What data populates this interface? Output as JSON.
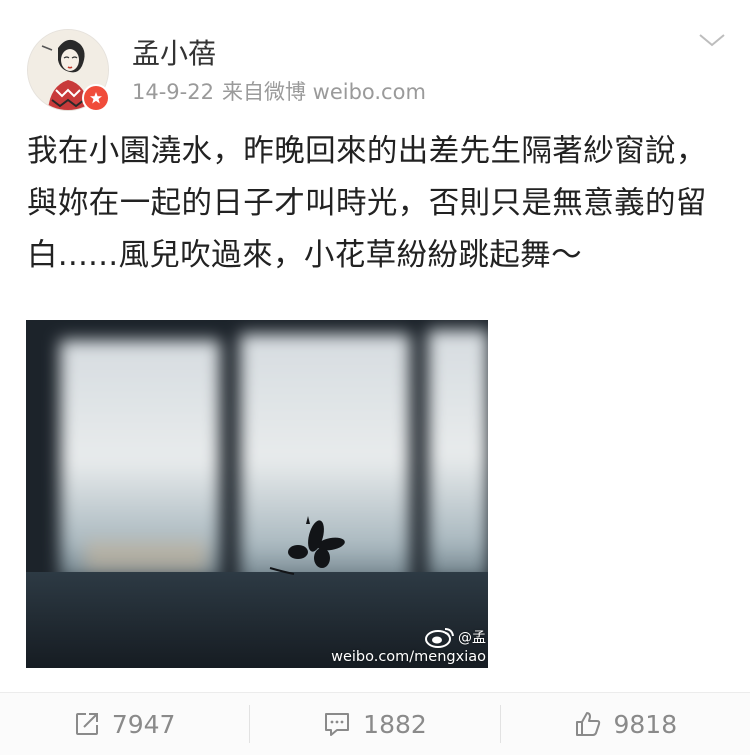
{
  "post": {
    "author": "孟小蓓",
    "date": "14-9-22",
    "source": "来自微博 weibo.com",
    "text": "我在小園澆水，昨晚回來的出差先生隔著紗窗說，與妳在一起的日子才叫時光，否則只是無意義的留白......風兒吹過來，小花草紛紛跳起舞～",
    "image": {
      "watermark_handle": "@孟",
      "watermark_url": "weibo.com/mengxiao"
    }
  },
  "actions": {
    "repost_count": "7947",
    "comment_count": "1882",
    "like_count": "9818"
  },
  "colors": {
    "badge": "#f04c3a",
    "text": "#222222",
    "meta": "#9a9a9a",
    "icon": "#8a8a8a"
  },
  "icons": [
    "avatar",
    "verified-badge-icon",
    "chevron-down-icon",
    "weibo-logo-icon",
    "repost-icon",
    "comment-icon",
    "like-icon"
  ]
}
